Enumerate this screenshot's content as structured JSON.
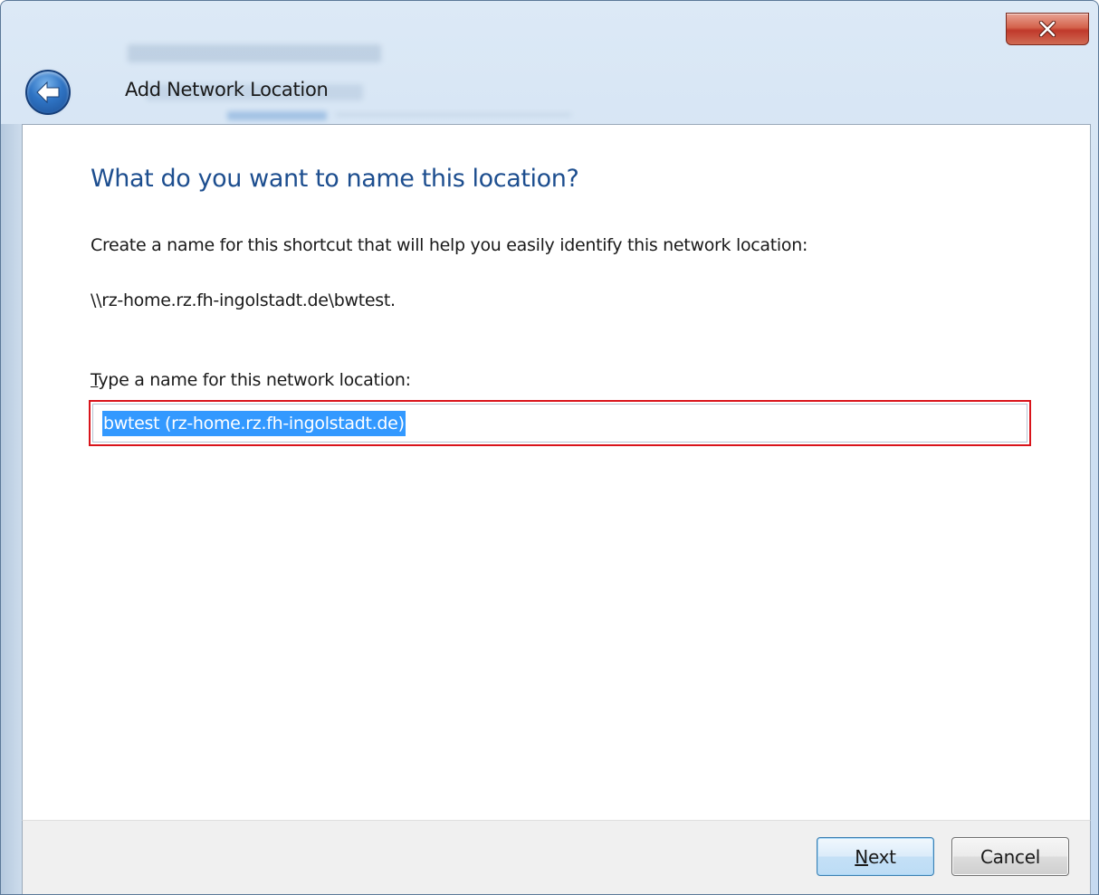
{
  "window": {
    "title": "Add Network Location"
  },
  "page": {
    "heading": "What do you want to name this location?",
    "instruction": "Create a name for this shortcut that will help you easily identify this network location:",
    "path": "\\\\rz-home.rz.fh-ingolstadt.de\\bwtest.",
    "field_label_mnemonic": "T",
    "field_label_rest": "ype a name for this network location:",
    "name_value": "bwtest (rz-home.rz.fh-ingolstadt.de)"
  },
  "buttons": {
    "next_mnemonic": "N",
    "next_rest": "ext",
    "cancel": "Cancel"
  },
  "icons": {
    "back": "back-arrow-icon",
    "close": "close-icon"
  },
  "colors": {
    "heading": "#1d4e8f",
    "selection": "#3399ff",
    "highlight_border": "#d9141b",
    "close_button": "#c0392b"
  }
}
